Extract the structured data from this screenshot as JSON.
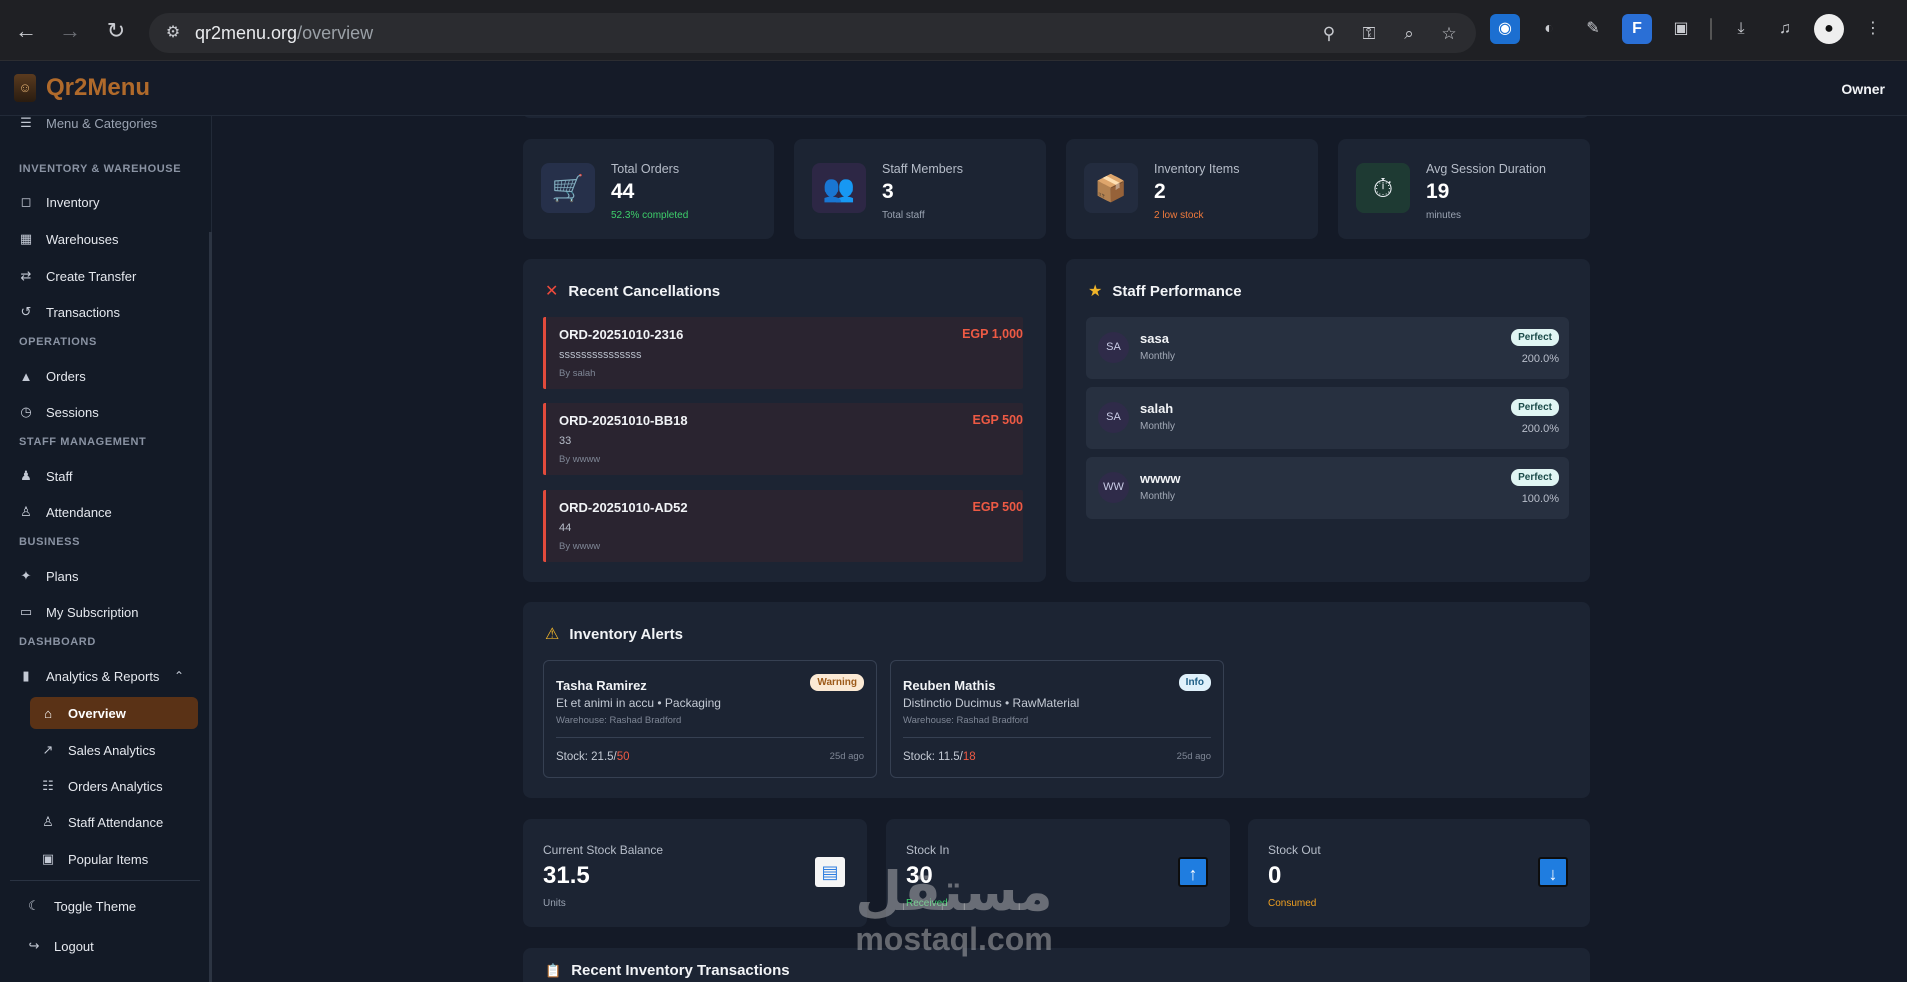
{
  "browser": {
    "url_host": "qr2menu.org",
    "url_path": "/overview"
  },
  "app": {
    "brand": "Qr2Menu",
    "user_role": "Owner"
  },
  "sidebar": {
    "partial_item": "Menu & Categories",
    "sections": {
      "inventory": "INVENTORY & WAREHOUSE",
      "operations": "OPERATIONS",
      "staff": "STAFF MANAGEMENT",
      "business": "BUSINESS",
      "dashboard": "DASHBOARD"
    },
    "items": {
      "inventory": "Inventory",
      "warehouses": "Warehouses",
      "create_transfer": "Create Transfer",
      "transactions": "Transactions",
      "orders": "Orders",
      "sessions": "Sessions",
      "staff": "Staff",
      "attendance": "Attendance",
      "plans": "Plans",
      "subscription": "My Subscription",
      "analytics": "Analytics & Reports",
      "overview": "Overview",
      "sales_analytics": "Sales Analytics",
      "orders_analytics": "Orders Analytics",
      "staff_attendance": "Staff Attendance",
      "popular_items": "Popular Items",
      "toggle_theme": "Toggle Theme",
      "logout": "Logout"
    }
  },
  "stats": [
    {
      "label": "Total Orders",
      "value": "44",
      "sub": "52.3% completed",
      "sub_color": "#3ecf6b"
    },
    {
      "label": "Staff Members",
      "value": "3",
      "sub": "Total staff",
      "sub_color": "#9aa3b2"
    },
    {
      "label": "Inventory Items",
      "value": "2",
      "sub": "2 low stock",
      "sub_color": "#f07a3c"
    },
    {
      "label": "Avg Session Duration",
      "value": "19",
      "sub": "minutes",
      "sub_color": "#9aa3b2"
    }
  ],
  "cancellations": {
    "title": "Recent Cancellations",
    "rows": [
      {
        "order_id": "ORD-20251010-2316",
        "amount": "EGP 1,000",
        "note": "sssssssssssssss",
        "by": "By salah"
      },
      {
        "order_id": "ORD-20251010-BB18",
        "amount": "EGP 500",
        "note": "33",
        "by": "By wwww"
      },
      {
        "order_id": "ORD-20251010-AD52",
        "amount": "EGP 500",
        "note": "44",
        "by": "By wwww"
      }
    ]
  },
  "performance": {
    "title": "Staff Performance",
    "rows": [
      {
        "initials": "SA",
        "name": "sasa",
        "period": "Monthly",
        "badge": "Perfect",
        "pct": "200.0%"
      },
      {
        "initials": "SA",
        "name": "salah",
        "period": "Monthly",
        "badge": "Perfect",
        "pct": "200.0%"
      },
      {
        "initials": "WW",
        "name": "wwww",
        "period": "Monthly",
        "badge": "Perfect",
        "pct": "100.0%"
      }
    ]
  },
  "alerts": {
    "title": "Inventory Alerts",
    "cards": [
      {
        "name": "Tasha Ramirez",
        "badge": "Warning",
        "desc": "Et et animi in accu • Packaging",
        "warehouse": "Warehouse: Rashad Bradford",
        "stock_label": "Stock: 21.5/",
        "stock_max": "50",
        "ago": "25d ago"
      },
      {
        "name": "Reuben Mathis",
        "badge": "Info",
        "desc": "Distinctio Ducimus • RawMaterial",
        "warehouse": "Warehouse: Rashad Bradford",
        "stock_label": "Stock: 11.5/",
        "stock_max": "18",
        "ago": "25d ago"
      }
    ]
  },
  "stock": [
    {
      "label": "Current Stock Balance",
      "value": "31.5",
      "sub": "Units",
      "sub_color": "#9aa3b2",
      "icon": "bar-chart-icon"
    },
    {
      "label": "Stock In",
      "value": "30",
      "sub": "Received",
      "sub_color": "#3ecf6b",
      "icon": "arrow-up-icon"
    },
    {
      "label": "Stock Out",
      "value": "0",
      "sub": "Consumed",
      "sub_color": "#f0a020",
      "icon": "arrow-down-icon"
    }
  ],
  "transactions_title": "Recent Inventory Transactions",
  "watermark": {
    "arabic": "مستقل",
    "latin": "mostaql.com"
  }
}
